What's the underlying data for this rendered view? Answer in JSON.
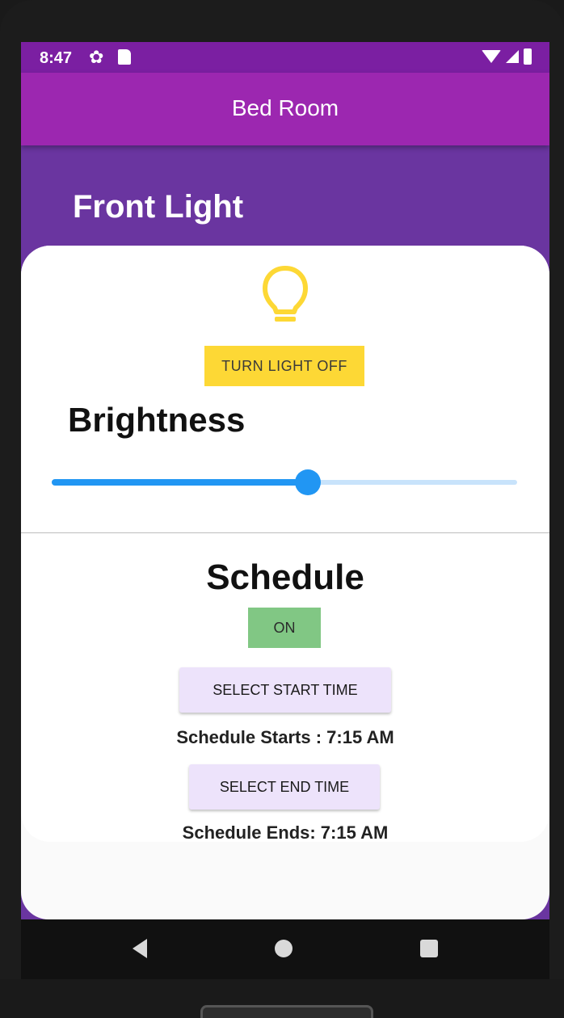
{
  "status_bar": {
    "time": "8:47",
    "icons": [
      "settings-icon",
      "sd-card-icon",
      "wifi-icon",
      "signal-icon",
      "battery-icon"
    ]
  },
  "app_bar": {
    "title": "Bed Room"
  },
  "device": {
    "name": "Front Light"
  },
  "light_control": {
    "bulb_icon": "lightbulb-icon",
    "bulb_color": "#fdd835",
    "toggle_label": "TURN LIGHT OFF"
  },
  "brightness": {
    "title": "Brightness",
    "value_fraction": 0.55,
    "accent_color": "#2196f3"
  },
  "schedule": {
    "title": "Schedule",
    "toggle_label": "ON",
    "toggle_color": "#81c784",
    "start_button_label": "SELECT START TIME",
    "start_text": "Schedule Starts : 7:15 AM",
    "end_button_label": "SELECT END TIME",
    "end_text": "Schedule Ends: 7:15 AM"
  },
  "colors": {
    "app_bar": "#9c27b0",
    "status_bar": "#7b1fa2",
    "background": "#6a35a0"
  },
  "nav_bar": {
    "icons": [
      "back-icon",
      "home-icon",
      "recents-icon"
    ]
  }
}
